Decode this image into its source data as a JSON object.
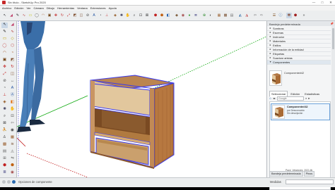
{
  "window": {
    "title": "Sin título - SketchUp Pro 2020",
    "minimize": "—",
    "maximize": "□",
    "close": "✕"
  },
  "menu": [
    "Archivo",
    "Edición",
    "Ver",
    "Cámara",
    "Dibujo",
    "Herramientas",
    "Ventana",
    "Extensiones",
    "Ayuda"
  ],
  "toolbar": {
    "icons": [
      "select-arrow",
      "eraser",
      "pencil-line",
      "freehand",
      "rectangle",
      "circle",
      "arc",
      "push-pull",
      "move",
      "rotate",
      "scale",
      "follow-me",
      "offset",
      "tape-measure",
      "text",
      "protractor",
      "dimension",
      "axes",
      "paint-bucket",
      "orbit",
      "pan",
      "zoom",
      "zoom-window",
      "zoom-extents",
      "warehouse",
      "extension-warehouse",
      "components",
      "materials",
      "styles",
      "layers"
    ]
  },
  "lefttools": {
    "icons": [
      "select",
      "eraser",
      "line",
      "freehand",
      "rectangle",
      "rotated-rectangle",
      "circle",
      "polygon",
      "arc",
      "pie",
      "push-pull",
      "follow-me",
      "move",
      "rotate",
      "scale",
      "offset",
      "tape-measure",
      "dimension",
      "protractor",
      "text",
      "axes",
      "3d-text",
      "paint-bucket",
      "section-plane",
      "orbit",
      "pan",
      "zoom",
      "zoom-window",
      "zoom-extents",
      "previous-view",
      "walk",
      "look-around",
      "position-camera",
      "sandbox-from-contours",
      "sandbox-from-scratch",
      "smoove",
      "stamp",
      "drape",
      "add-detail",
      "flip-edge",
      "warehouse",
      "extension"
    ]
  },
  "status": {
    "hint": "Opciones de componente",
    "measure_label": "Medidas"
  },
  "tray": {
    "title": "Bandeja predeterminada",
    "panels": [
      {
        "label": "Sombras",
        "expanded": false
      },
      {
        "label": "Escenas",
        "expanded": false
      },
      {
        "label": "Instructor",
        "expanded": false
      },
      {
        "label": "Materiales",
        "expanded": false
      },
      {
        "label": "Estilos",
        "expanded": false
      },
      {
        "label": "Información de la entidad",
        "expanded": false
      },
      {
        "label": "Etiquetas",
        "expanded": false
      },
      {
        "label": "Suavizar aristas",
        "expanded": false
      },
      {
        "label": "Componentes",
        "expanded": true
      }
    ],
    "component": {
      "name": "Componente#42",
      "tabs": [
        "Seleccionar",
        "Edición",
        "Estadísticas"
      ],
      "active_tab": "Seleccionar",
      "search_placeholder": "Google",
      "item_name": "Componente#42",
      "item_line1": "por Desconocido",
      "item_line2": "Sin descripción",
      "path": "Pack_Veladores_2021.lib"
    },
    "bottom_tabs": [
      "Bandeja predeterminada",
      "Pinos"
    ]
  },
  "colors": {
    "accent": "#1a5fb4",
    "selection": "#3a3af0",
    "wood_light": "#d8b583",
    "wood_mid": "#b47b45",
    "wood_dark": "#8a5528",
    "axis_red": "#c01818",
    "axis_green": "#0ca80c",
    "axis_blue": "#2020d0"
  }
}
